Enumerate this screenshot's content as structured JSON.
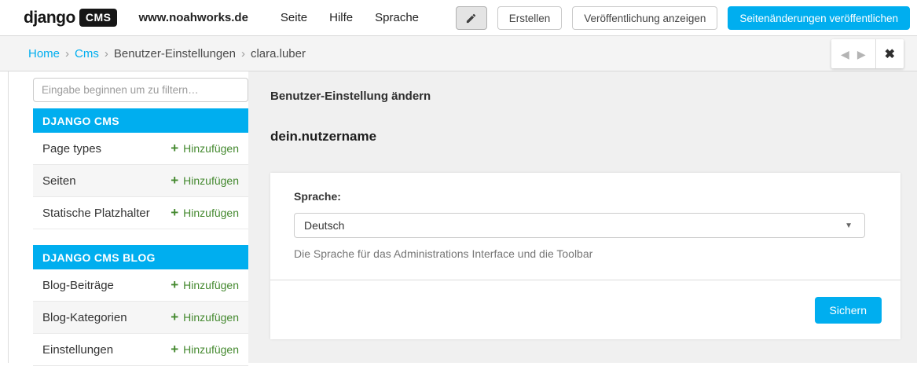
{
  "brand": {
    "name": "django",
    "badge": "CMS"
  },
  "toolbar": {
    "site": "www.noahworks.de",
    "menus": [
      "Seite",
      "Hilfe",
      "Sprache"
    ],
    "buttons": {
      "create": "Erstellen",
      "view_published": "Veröffentlichung anzeigen",
      "publish": "Seitenänderungen veröffentlichen"
    }
  },
  "breadcrumb": {
    "items": [
      "Home",
      "Cms",
      "Benutzer-Einstellungen",
      "clara.luber"
    ],
    "separator": "›"
  },
  "pager": {
    "prev": "◀",
    "next": "▶",
    "close": "✖"
  },
  "sidebar": {
    "filter_placeholder": "Eingabe beginnen um zu filtern…",
    "add_icon": "+",
    "add_label": "Hinzufügen",
    "sections": [
      {
        "title": "DJANGO CMS",
        "items": [
          "Page types",
          "Seiten",
          "Statische Platzhalter"
        ]
      },
      {
        "title": "DJANGO CMS BLOG",
        "items": [
          "Blog-Beiträge",
          "Blog-Kategorien",
          "Einstellungen"
        ]
      }
    ]
  },
  "main": {
    "title": "Benutzer-Einstellung ändern",
    "username": "dein.nutzername",
    "form": {
      "language_label": "Sprache:",
      "language_value": "Deutsch",
      "language_help": "Die Sprache für das Administrations Interface und die Toolbar",
      "save_label": "Sichern"
    }
  },
  "colors": {
    "accent": "#00aeef",
    "add_green": "#44892f",
    "logo_black": "#161616"
  }
}
